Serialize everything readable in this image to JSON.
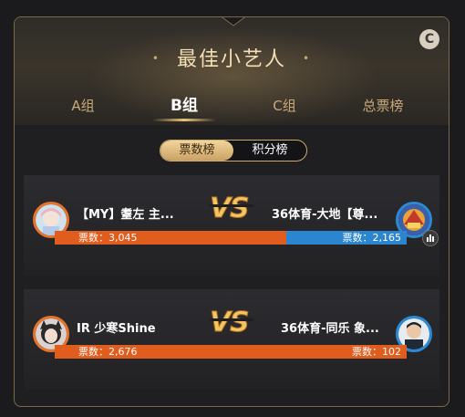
{
  "widget": {
    "title": "最佳小艺人",
    "title_dots": [
      "•",
      "•"
    ],
    "refresh_glyph": "C"
  },
  "tabs": [
    {
      "label": "A组",
      "active": false
    },
    {
      "label": "B组",
      "active": true
    },
    {
      "label": "C组",
      "active": false
    },
    {
      "label": "总票榜",
      "active": false
    }
  ],
  "toggle": {
    "options": [
      "票数榜",
      "积分榜"
    ],
    "selected": "票数榜"
  },
  "vs_text": "VS",
  "matches": [
    {
      "left": {
        "name": "【MY】耋左 主...",
        "votes_label": "票数：3,045",
        "votes": 3045,
        "avatar": "anime-girl-avatar",
        "ring_color": "#e8732a"
      },
      "right": {
        "name": "36体育-大地【尊...",
        "votes_label": "票数：2,165",
        "votes": 2165,
        "avatar": "game-art-avatar",
        "ring_color": "#2b8ad6"
      },
      "left_share": 0.658
    },
    {
      "left": {
        "name": "IR 少寒Shine",
        "votes_label": "票数：2,676",
        "votes": 2676,
        "avatar": "cat-ear-girl-avatar",
        "ring_color": "#e8732a"
      },
      "right": {
        "name": "36体育-同乐 象...",
        "votes_label": "票数：102",
        "votes": 102,
        "avatar": "man-photo-avatar",
        "ring_color": "#2b8ad6"
      },
      "left_share": 1.0
    }
  ],
  "colors": {
    "gold": "#c9a96e",
    "orange": "#e05d1e",
    "blue": "#2b86cf"
  }
}
